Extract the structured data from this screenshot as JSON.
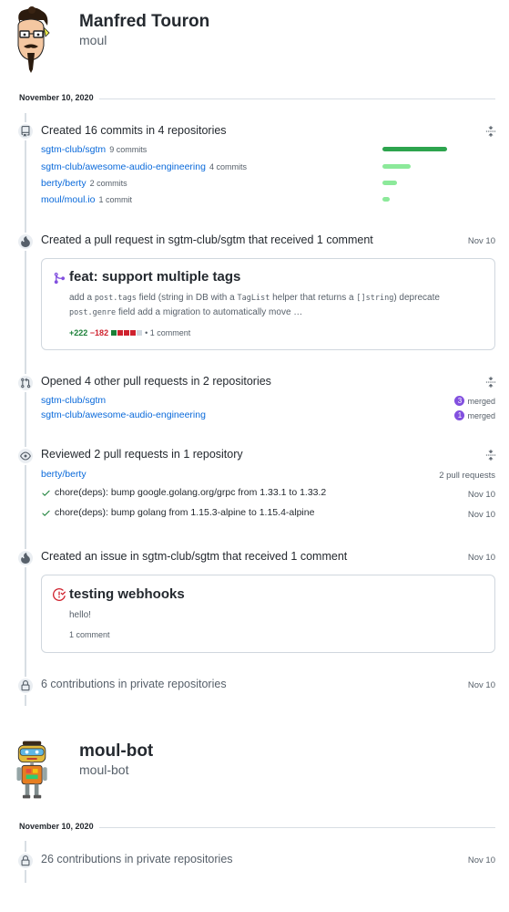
{
  "profiles": [
    {
      "name": "Manfred Touron",
      "login": "moul",
      "date_month_day": "November 10,",
      "date_year": "2020",
      "events": {
        "commits": {
          "title": "Created 16 commits in 4 repositories",
          "repos": [
            {
              "name": "sgtm-club/sgtm",
              "count": "9 commits",
              "share": 1.0
            },
            {
              "name": "sgtm-club/awesome-audio-engineering",
              "count": "4 commits",
              "share": 0.44
            },
            {
              "name": "berty/berty",
              "count": "2 commits",
              "share": 0.22
            },
            {
              "name": "moul/moul.io",
              "count": "1 commit",
              "share": 0.11
            }
          ],
          "colors": {
            "strong": "#2da44e",
            "light": "#8ce99a"
          }
        },
        "pr_created": {
          "title": "Created a pull request in sgtm-club/sgtm that received 1 comment",
          "date": "Nov 10",
          "card_title": "feat: support multiple tags",
          "body": {
            "t1": "add a ",
            "c1": "post.tags",
            "t2": " field (string in DB with a ",
            "c2": "TagList",
            "t3": " helper that returns a ",
            "c3": "[]string",
            "t4": ") deprecate",
            "c4": "post.genre",
            "t5": " field add a migration to automatically move …"
          },
          "additions": "+222",
          "deletions": "−182",
          "comments": "• 1 comment"
        },
        "prs_opened": {
          "title": "Opened 4 other pull requests in 2 repositories",
          "repos": [
            {
              "name": "sgtm-club/sgtm",
              "count": "3",
              "status": "merged"
            },
            {
              "name": "sgtm-club/awesome-audio-engineering",
              "count": "1",
              "status": "merged"
            }
          ]
        },
        "reviewed": {
          "title": "Reviewed 2 pull requests in 1 repository",
          "repo": "berty/berty",
          "repo_count": "2 pull requests",
          "items": [
            {
              "title": "chore(deps): bump google.golang.org/grpc from 1.33.1 to 1.33.2",
              "date": "Nov 10"
            },
            {
              "title": "chore(deps): bump golang from 1.15.3-alpine to 1.15.4-alpine",
              "date": "Nov 10"
            }
          ]
        },
        "issue": {
          "title": "Created an issue in sgtm-club/sgtm that received 1 comment",
          "date": "Nov 10",
          "card_title": "testing webhooks",
          "body": "hello!",
          "comments": "1 comment"
        },
        "private": {
          "title": "6 contributions in private repositories",
          "date": "Nov 10"
        }
      }
    },
    {
      "name": "moul-bot",
      "login": "moul-bot",
      "date_month_day": "November 10,",
      "date_year": "2020",
      "private": {
        "title": "26 contributions in private repositories",
        "date": "Nov 10"
      }
    }
  ]
}
